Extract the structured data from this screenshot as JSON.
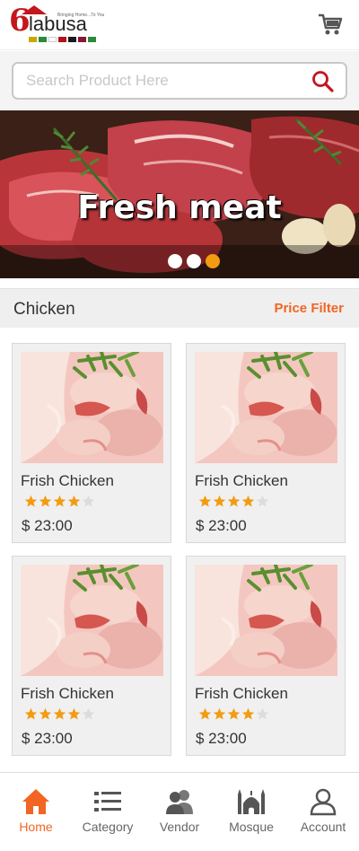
{
  "brand": {
    "name": "labusa",
    "prefix": "6",
    "tagline": "Bringing Home...To You"
  },
  "search": {
    "placeholder": "Search Product Here",
    "value": ""
  },
  "banner": {
    "title": "Fresh meat",
    "slides": 3,
    "active_slide": 3
  },
  "section": {
    "title": "Chicken",
    "filter_label": "Price Filter"
  },
  "products": [
    {
      "name": "Frish Chicken",
      "price": "$  23:00",
      "rating": 4,
      "max_rating": 5
    },
    {
      "name": "Frish Chicken",
      "price": "$  23:00",
      "rating": 4,
      "max_rating": 5
    },
    {
      "name": "Frish Chicken",
      "price": "$  23:00",
      "rating": 4,
      "max_rating": 5
    },
    {
      "name": "Frish Chicken",
      "price": "$  23:00",
      "rating": 4,
      "max_rating": 5
    }
  ],
  "nav": {
    "items": [
      {
        "label": "Home",
        "icon": "home-icon",
        "active": true
      },
      {
        "label": "Category",
        "icon": "list-icon",
        "active": false
      },
      {
        "label": "Vendor",
        "icon": "users-icon",
        "active": false
      },
      {
        "label": "Mosque",
        "icon": "mosque-icon",
        "active": false
      },
      {
        "label": "Account",
        "icon": "user-icon",
        "active": false
      }
    ]
  },
  "colors": {
    "accent": "#f26522",
    "star": "#f39c12",
    "star_empty": "#dcdcdc",
    "brand_red": "#c4161c"
  }
}
